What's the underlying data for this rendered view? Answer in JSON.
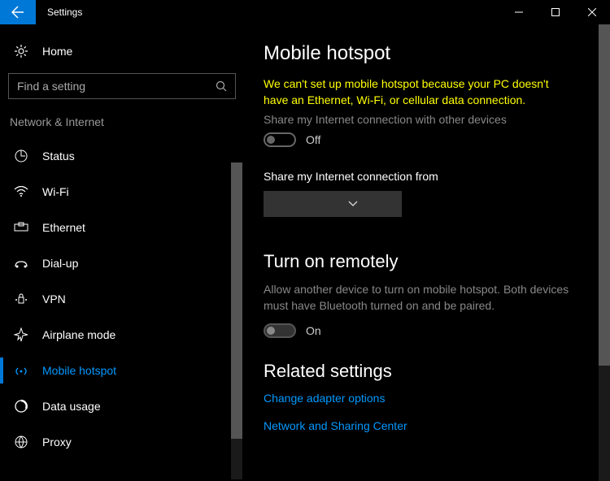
{
  "window": {
    "title": "Settings"
  },
  "sidebar": {
    "home_label": "Home",
    "search_placeholder": "Find a setting",
    "category": "Network & Internet",
    "items": [
      {
        "label": "Status"
      },
      {
        "label": "Wi-Fi"
      },
      {
        "label": "Ethernet"
      },
      {
        "label": "Dial-up"
      },
      {
        "label": "VPN"
      },
      {
        "label": "Airplane mode"
      },
      {
        "label": "Mobile hotspot"
      },
      {
        "label": "Data usage"
      },
      {
        "label": "Proxy"
      }
    ]
  },
  "main": {
    "heading": "Mobile hotspot",
    "warning": "We can't set up mobile hotspot because your PC doesn't have an Ethernet, Wi-Fi, or cellular data connection.",
    "share_label": "Share my Internet connection with other devices",
    "share_toggle_state": "Off",
    "share_from_label": "Share my Internet connection from",
    "remote_heading": "Turn on remotely",
    "remote_desc": "Allow another device to turn on mobile hotspot. Both devices must have Bluetooth turned on and be paired.",
    "remote_toggle_state": "On",
    "related_heading": "Related settings",
    "link1": "Change adapter options",
    "link2": "Network and Sharing Center"
  }
}
